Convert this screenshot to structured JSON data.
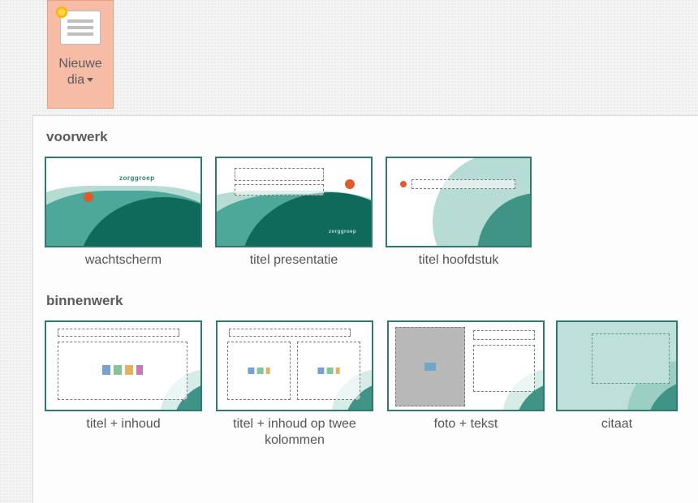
{
  "new_slide_button": {
    "line1": "Nieuwe",
    "line2": "dia"
  },
  "sections": {
    "voorwerk": {
      "header": "voorwerk",
      "items": [
        {
          "label": "wachtscherm"
        },
        {
          "label": "titel presentatie"
        },
        {
          "label": "titel hoofdstuk"
        }
      ]
    },
    "binnenwerk": {
      "header": "binnenwerk",
      "items": [
        {
          "label": "titel + inhoud"
        },
        {
          "label": "titel + inhoud op twee kolommen"
        },
        {
          "label": "foto + tekst"
        },
        {
          "label": "citaat"
        }
      ]
    }
  },
  "logo_text": "zorggroep"
}
